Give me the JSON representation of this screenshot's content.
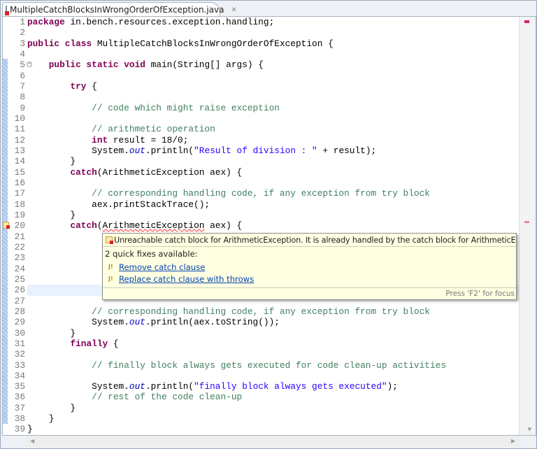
{
  "tab": {
    "title": "MultipleCatchBlocksInWrongOrderOfException.java",
    "close_icon": "close-icon"
  },
  "code": [
    [
      [
        "kw",
        "package"
      ],
      [
        "p",
        " in.bench.resources.exception.handling;"
      ]
    ],
    [],
    [
      [
        "kw",
        "public"
      ],
      [
        "p",
        " "
      ],
      [
        "kw",
        "class"
      ],
      [
        "p",
        " MultipleCatchBlocksInWrongOrderOfException {"
      ]
    ],
    [],
    [
      [
        "p",
        "    "
      ],
      [
        "kw",
        "public"
      ],
      [
        "p",
        " "
      ],
      [
        "kw",
        "static"
      ],
      [
        "p",
        " "
      ],
      [
        "kw",
        "void"
      ],
      [
        "p",
        " main(String[] args) {"
      ]
    ],
    [],
    [
      [
        "p",
        "        "
      ],
      [
        "kw",
        "try"
      ],
      [
        "p",
        " {"
      ]
    ],
    [],
    [
      [
        "p",
        "            "
      ],
      [
        "cm",
        "// code which might raise exception"
      ]
    ],
    [],
    [
      [
        "p",
        "            "
      ],
      [
        "cm",
        "// arithmetic operation"
      ]
    ],
    [
      [
        "p",
        "            "
      ],
      [
        "kw",
        "int"
      ],
      [
        "p",
        " result = 18/0;"
      ]
    ],
    [
      [
        "p",
        "            System."
      ],
      [
        "sf",
        "out"
      ],
      [
        "p",
        ".println("
      ],
      [
        "st",
        "\"Result of division : \""
      ],
      [
        "p",
        " + result);"
      ]
    ],
    [
      [
        "p",
        "        }"
      ]
    ],
    [
      [
        "p",
        "        "
      ],
      [
        "kw",
        "catch"
      ],
      [
        "p",
        "(ArithmeticException aex) {"
      ]
    ],
    [],
    [
      [
        "p",
        "            "
      ],
      [
        "cm",
        "// corresponding handling code, if any exception from try block"
      ]
    ],
    [
      [
        "p",
        "            aex.printStackTrace();"
      ]
    ],
    [
      [
        "p",
        "        }"
      ]
    ],
    [
      [
        "p",
        "        "
      ],
      [
        "kw",
        "catch"
      ],
      [
        "p",
        "("
      ],
      [
        "err",
        "ArithmeticException"
      ],
      [
        "p",
        " aex) {"
      ]
    ],
    [],
    [],
    [],
    [],
    [],
    [],
    [],
    [
      [
        "p",
        "            "
      ],
      [
        "cm",
        "// corresponding handling code, if any exception from try block"
      ]
    ],
    [
      [
        "p",
        "            System."
      ],
      [
        "sf",
        "out"
      ],
      [
        "p",
        ".println(aex.toString());"
      ]
    ],
    [
      [
        "p",
        "        }"
      ]
    ],
    [
      [
        "p",
        "        "
      ],
      [
        "kw",
        "finally"
      ],
      [
        "p",
        " {"
      ]
    ],
    [],
    [
      [
        "p",
        "            "
      ],
      [
        "cm",
        "// finally block always gets executed for code clean-up activities"
      ]
    ],
    [],
    [
      [
        "p",
        "            System."
      ],
      [
        "sf",
        "out"
      ],
      [
        "p",
        ".println("
      ],
      [
        "st",
        "\"finally block always gets executed\""
      ],
      [
        "p",
        ");"
      ]
    ],
    [
      [
        "p",
        "            "
      ],
      [
        "cm",
        "// rest of the code clean-up"
      ]
    ],
    [
      [
        "p",
        "        }"
      ]
    ],
    [
      [
        "p",
        "    }"
      ]
    ],
    [
      [
        "p",
        "}"
      ]
    ]
  ],
  "current_line": 26,
  "error_line": 20,
  "fold_line": 5,
  "popup": {
    "message": "Unreachable catch block for ArithmeticException. It is already handled by the catch block for ArithmeticException",
    "count": "2 quick fixes available:",
    "fixes": [
      "Remove catch clause",
      "Replace catch clause with throws"
    ],
    "footer": "Press 'F2' for focus"
  },
  "colors": {
    "keyword": "#7f0055",
    "comment": "#3f7f5f",
    "string": "#2a00ff",
    "static_field": "#0000c0",
    "error": "#d22",
    "current_line": "#e8f2fe",
    "tooltip": "#ffffe1"
  }
}
